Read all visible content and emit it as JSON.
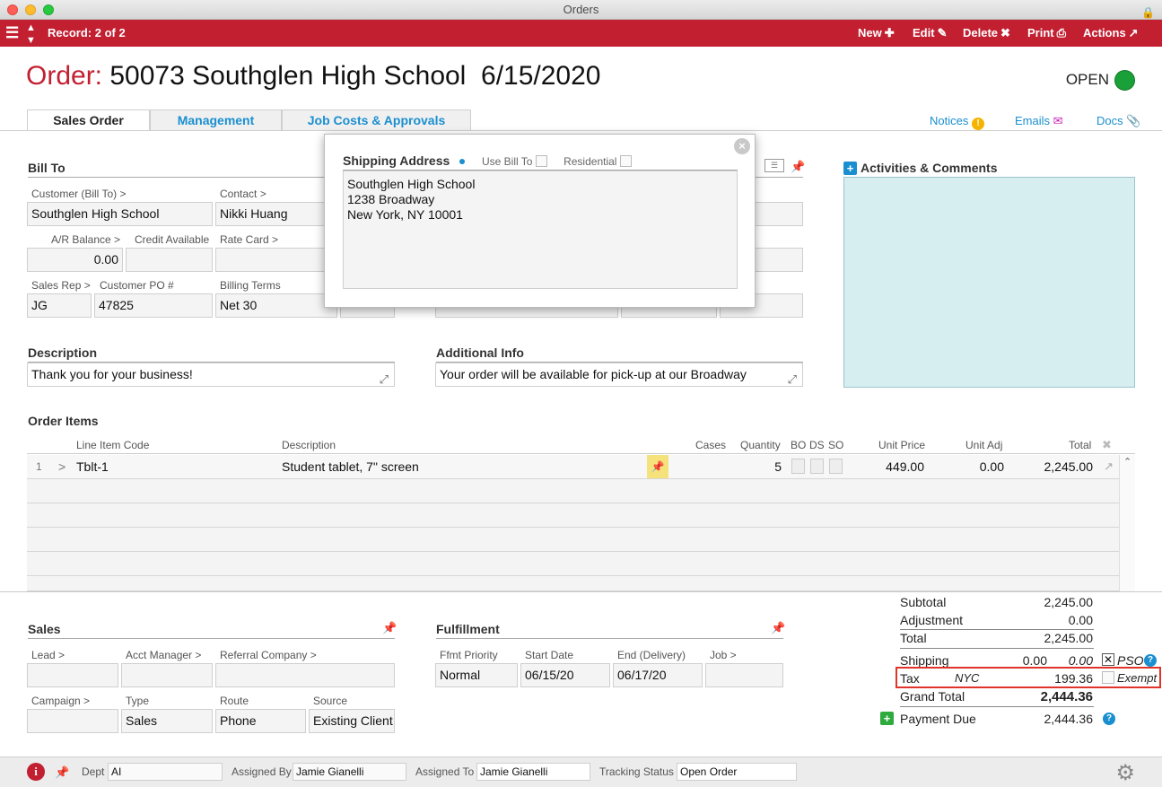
{
  "window": {
    "title": "Orders"
  },
  "toolbar": {
    "record": "Record: 2 of 2",
    "new_label": "New",
    "edit_label": "Edit",
    "delete_label": "Delete",
    "print_label": "Print",
    "actions_label": "Actions"
  },
  "order": {
    "label": "Order:",
    "title": "50073 Southglen High School  6/15/2020",
    "status": "OPEN",
    "status_color": "#1aa038"
  },
  "tabs": [
    {
      "label": "Sales Order"
    },
    {
      "label": "Management"
    },
    {
      "label": "Job Costs & Approvals"
    }
  ],
  "links": {
    "notices": "Notices",
    "emails": "Emails",
    "docs": "Docs"
  },
  "bill_to": {
    "heading": "Bill To",
    "customer_label": "Customer (Bill To) >",
    "customer": "Southglen High School",
    "contact_label": "Contact >",
    "contact": "Nikki Huang",
    "ar_balance_label": "A/R Balance >",
    "ar_balance": "0.00",
    "credit_label": "Credit Available",
    "credit": "",
    "rate_card_label": "Rate Card >",
    "rate_card": "",
    "sales_rep_label": "Sales Rep >",
    "sales_rep": "JG",
    "po_label": "Customer PO #",
    "po": "47825",
    "terms_label": "Billing Terms",
    "terms": "Net 30"
  },
  "shipping_popup": {
    "heading": "Shipping Address",
    "use_bill_to": "Use Bill To",
    "residential": "Residential",
    "line1": "Southglen High School",
    "line2": "1238 Broadway",
    "line3": "New York, NY 10001"
  },
  "activities": {
    "heading": "Activities & Comments"
  },
  "description": {
    "heading": "Description",
    "value": "Thank you for your business!"
  },
  "additional_info": {
    "heading": "Additional Info",
    "value": "Your order will be available for pick-up at our Broadway"
  },
  "order_items": {
    "heading": "Order Items",
    "columns": {
      "code": "Line Item Code",
      "description": "Description",
      "cases": "Cases",
      "quantity": "Quantity",
      "bo": "BO",
      "ds": "DS",
      "so": "SO",
      "unit_price": "Unit Price",
      "unit_adj": "Unit Adj",
      "total": "Total"
    },
    "rows": [
      {
        "num": "1",
        "code": "Tblt-1",
        "description": "Student tablet, 7\" screen",
        "cases": "",
        "quantity": "5",
        "unit_price": "449.00",
        "unit_adj": "0.00",
        "total": "2,245.00"
      }
    ]
  },
  "sales": {
    "heading": "Sales",
    "lead_label": "Lead >",
    "lead": "",
    "acct_mgr_label": "Acct Manager >",
    "acct_mgr": "",
    "referral_label": "Referral Company >",
    "referral": "",
    "campaign_label": "Campaign >",
    "campaign": "",
    "type_label": "Type",
    "type": "Sales",
    "route_label": "Route",
    "route": "Phone",
    "source_label": "Source",
    "source": "Existing Client"
  },
  "fulfillment": {
    "heading": "Fulfillment",
    "priority_label": "Ffmt Priority",
    "priority": "Normal",
    "start_label": "Start Date",
    "start": "06/15/20",
    "end_label": "End (Delivery)",
    "end": "06/17/20",
    "job_label": "Job >",
    "job": ""
  },
  "totals": {
    "subtotal_label": "Subtotal",
    "subtotal": "2,245.00",
    "adjustment_label": "Adjustment",
    "adjustment": "0.00",
    "total_label": "Total",
    "total": "2,245.00",
    "shipping_label": "Shipping",
    "shipping": "0.00",
    "shipping_italic": "0.00",
    "pso": "PSO",
    "tax_label": "Tax",
    "tax_code": "NYC",
    "tax": "199.36",
    "exempt": "Exempt",
    "grand_total_label": "Grand Total",
    "grand_total": "2,444.36",
    "payment_due_label": "Payment Due",
    "payment_due": "2,444.36"
  },
  "footer": {
    "dept_label": "Dept",
    "dept": "AI",
    "assigned_by_label": "Assigned By",
    "assigned_by": "Jamie Gianelli",
    "assigned_to_label": "Assigned To",
    "assigned_to": "Jamie Gianelli",
    "tracking_label": "Tracking Status",
    "tracking": "Open Order"
  },
  "colors": {
    "brand_red": "#c21f31",
    "link_blue": "#1a8fd0",
    "highlight_red": "#e0332a"
  }
}
